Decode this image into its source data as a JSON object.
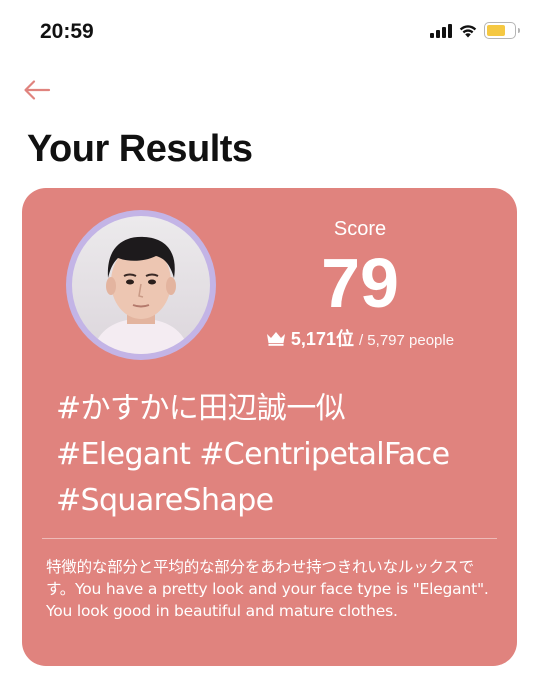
{
  "status_bar": {
    "time": "20:59",
    "icons": [
      "signal-icon",
      "wifi-icon",
      "battery-icon"
    ],
    "battery_color": "#f5c842"
  },
  "nav": {
    "back_icon": "arrow-left-icon",
    "back_color": "#e0837e"
  },
  "page": {
    "title": "Your Results"
  },
  "result": {
    "card_color": "#e0837e",
    "avatar_ring_color": "#c3b4e6",
    "score_label": "Score",
    "score": "79",
    "rank_icon": "crown-icon",
    "rank": "5,171位",
    "rank_total": "/ 5,797 people",
    "hashtags": [
      "#かすかに田辺誠一似",
      "#Elegant #CentripetalFace",
      "#SquareShape"
    ],
    "description": "特徴的な部分と平均的な部分をあわせ持つきれいなルックスです。You have a pretty look and your face type is \"Elegant\". You look good in beautiful and mature clothes."
  }
}
